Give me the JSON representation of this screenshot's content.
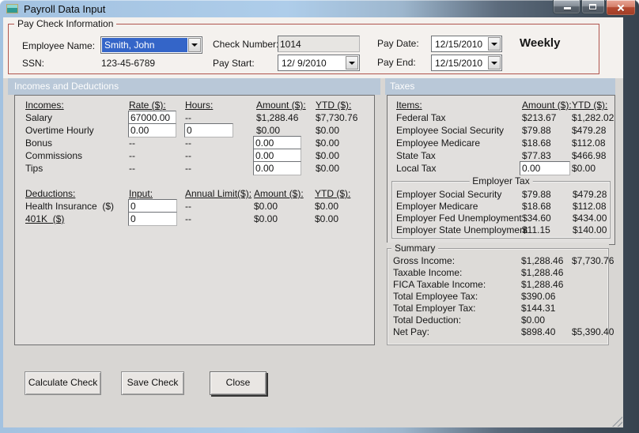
{
  "window": {
    "title": "Payroll Data Input"
  },
  "colors": {
    "section_band": "#b9c8d8",
    "paycheck_group_border": "#b0554d",
    "combo_selection": "#3465c8",
    "close_button_red": "#b44a31"
  },
  "paycheck": {
    "legend": "Pay Check Information",
    "employee_name": {
      "label": "Employee Name:",
      "value": "Smith, John"
    },
    "ssn": {
      "label": "SSN:",
      "value": "123-45-6789"
    },
    "check_number": {
      "label": "Check Number:",
      "value": "1014"
    },
    "pay_start": {
      "label": "Pay Start:",
      "value": "12/ 9/2010"
    },
    "pay_date": {
      "label": "Pay Date:",
      "value": "12/15/2010"
    },
    "pay_end": {
      "label": "Pay End:",
      "value": "12/15/2010"
    },
    "frequency": "Weekly"
  },
  "incomes": {
    "header_label": "Incomes and Deductions",
    "columns": [
      "Incomes:",
      "Rate ($):",
      "Hours:",
      "Amount ($):",
      "YTD ($):"
    ],
    "rows": [
      {
        "label": "Salary",
        "rate": "67000.00",
        "rate_is_input": true,
        "hours": "--",
        "hours_is_input": false,
        "amount": "$1,288.46",
        "amount_is_input": false,
        "ytd": "$7,730.76"
      },
      {
        "label": "Overtime Hourly",
        "rate": "0.00",
        "rate_is_input": true,
        "hours": "0",
        "hours_is_input": true,
        "amount": "$0.00",
        "amount_is_input": false,
        "ytd": "$0.00"
      },
      {
        "label": "Bonus",
        "rate": "--",
        "rate_is_input": false,
        "hours": "--",
        "hours_is_input": false,
        "amount": "0.00",
        "amount_is_input": true,
        "ytd": "$0.00"
      },
      {
        "label": "Commissions",
        "rate": "--",
        "rate_is_input": false,
        "hours": "--",
        "hours_is_input": false,
        "amount": "0.00",
        "amount_is_input": true,
        "ytd": "$0.00"
      },
      {
        "label": "Tips",
        "rate": "--",
        "rate_is_input": false,
        "hours": "--",
        "hours_is_input": false,
        "amount": "0.00",
        "amount_is_input": true,
        "ytd": "$0.00"
      }
    ]
  },
  "deductions": {
    "columns": [
      "Deductions:",
      "Input:",
      "Annual Limit($):",
      "Amount ($):",
      "YTD ($):"
    ],
    "rows": [
      {
        "label": "Health Insurance  ($)",
        "label_underline": false,
        "input": "0",
        "limit": "--",
        "amount": "$0.00",
        "ytd": "$0.00"
      },
      {
        "label": "401K  ($)",
        "label_underline": true,
        "input": "0",
        "limit": "--",
        "amount": "$0.00",
        "ytd": "$0.00"
      }
    ]
  },
  "taxes": {
    "header_label": "Taxes",
    "columns": [
      "Items:",
      "Amount ($):",
      "YTD ($):"
    ],
    "rows": [
      {
        "label": "Federal Tax",
        "amount": "$213.67",
        "amount_is_input": false,
        "ytd": "$1,282.02"
      },
      {
        "label": "Employee Social Security",
        "amount": "$79.88",
        "amount_is_input": false,
        "ytd": "$479.28"
      },
      {
        "label": "Employee Medicare",
        "amount": "$18.68",
        "amount_is_input": false,
        "ytd": "$112.08"
      },
      {
        "label": "State Tax",
        "amount": "$77.83",
        "amount_is_input": false,
        "ytd": "$466.98"
      },
      {
        "label": "Local Tax",
        "amount": "0.00",
        "amount_is_input": true,
        "ytd": "$0.00"
      }
    ],
    "employer": {
      "legend": "Employer Tax",
      "rows": [
        {
          "label": "Employer Social Security",
          "amount": "$79.88",
          "ytd": "$479.28"
        },
        {
          "label": "Employer Medicare",
          "amount": "$18.68",
          "ytd": "$112.08"
        },
        {
          "label": "Employer Fed Unemployment",
          "amount": "$34.60",
          "ytd": "$434.00"
        },
        {
          "label": "Employer State Unemployment",
          "amount": "$11.15",
          "ytd": "$140.00"
        }
      ]
    }
  },
  "summary": {
    "legend": "Summary",
    "rows": [
      {
        "label": "Gross Income:",
        "amount": "$1,288.46",
        "ytd": "$7,730.76"
      },
      {
        "label": "Taxable Income:",
        "amount": "$1,288.46",
        "ytd": ""
      },
      {
        "label": "FICA Taxable Income:",
        "amount": "$1,288.46",
        "ytd": ""
      },
      {
        "label": "Total Employee Tax:",
        "amount": "$390.06",
        "ytd": ""
      },
      {
        "label": "Total Employer Tax:",
        "amount": "$144.31",
        "ytd": ""
      },
      {
        "label": "Total Deduction:",
        "amount": "$0.00",
        "ytd": ""
      },
      {
        "label": "Net Pay:",
        "amount": "$898.40",
        "ytd": "$5,390.40"
      }
    ]
  },
  "buttons": [
    {
      "label": "Calculate Check"
    },
    {
      "label": "Save Check"
    },
    {
      "label": "Close"
    }
  ]
}
